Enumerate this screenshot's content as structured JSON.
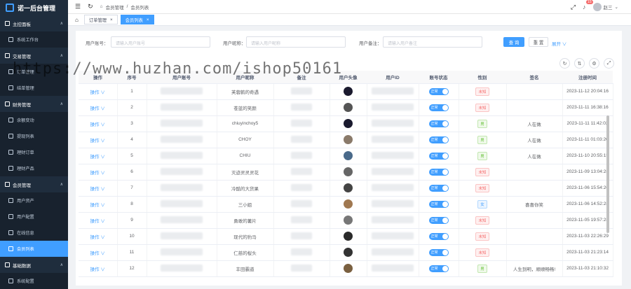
{
  "app": {
    "title": "诺一后台管理"
  },
  "sidebar": {
    "groups": [
      {
        "label": "主控面板",
        "items": [
          {
            "label": "系统工作台"
          }
        ]
      },
      {
        "label": "交易管理",
        "items": [
          {
            "label": "订单管理"
          },
          {
            "label": "结单管理"
          }
        ]
      },
      {
        "label": "财务管理",
        "items": [
          {
            "label": "余额变动"
          },
          {
            "label": "提现列表"
          },
          {
            "label": "理财订单"
          },
          {
            "label": "理财产品"
          }
        ]
      },
      {
        "label": "会员管理",
        "items": [
          {
            "label": "用户资产"
          },
          {
            "label": "用户配置"
          },
          {
            "label": "在线信息"
          },
          {
            "label": "会员列表"
          }
        ]
      },
      {
        "label": "基础数据",
        "items": [
          {
            "label": "系统配置"
          }
        ]
      }
    ],
    "active_item": "会员列表"
  },
  "header": {
    "breadcrumb": [
      "会员管理",
      "会员列表"
    ],
    "notification_count": "15",
    "user_name": "赵三"
  },
  "tabs": [
    {
      "label": "订单管理",
      "close": "×"
    },
    {
      "label": "会员列表",
      "close": "×"
    }
  ],
  "filters": {
    "account_label": "用户账号：",
    "account_placeholder": "请输入用户账号",
    "nickname_label": "用户昵称：",
    "nickname_placeholder": "请输入用户昵称",
    "remark_label": "用户备注：",
    "remark_placeholder": "请输入用户备注",
    "search_label": "查 询",
    "reset_label": "重 置",
    "expand_label": "展开 ∨"
  },
  "table": {
    "headers": [
      "操作",
      "序号",
      "用户账号",
      "用户昵称",
      "备注",
      "用户头像",
      "用户ID",
      "账号状态",
      "性别",
      "签名",
      "注册时间"
    ],
    "rows": [
      {
        "op": "操作 ∨",
        "index": "1",
        "nickname": "芙蓉鹤的奇遇",
        "status": "正常",
        "gender": "未知",
        "gender_type": "unknown",
        "signature": "",
        "time": "2023-11-12 20:04:16",
        "avatar_color": "#1a1a2e"
      },
      {
        "op": "操作 ∨",
        "index": "2",
        "nickname": "苍蓝的笑颜",
        "status": "正常",
        "gender": "未知",
        "gender_type": "unknown",
        "signature": "",
        "time": "2023-11-11 16:38:16",
        "avatar_color": "#555"
      },
      {
        "op": "操作 ∨",
        "index": "3",
        "nickname": "chiuyinchoy5",
        "status": "正常",
        "gender": "男",
        "gender_type": "female",
        "signature": "人在做",
        "time": "2023-11-11 11:42:03",
        "avatar_color": "#1a1a2e"
      },
      {
        "op": "操作 ∨",
        "index": "4",
        "nickname": "CHOY",
        "status": "正常",
        "gender": "男",
        "gender_type": "female",
        "signature": "人在做",
        "time": "2023-11-11 01:03:20",
        "avatar_color": "#8a7a6a"
      },
      {
        "op": "操作 ∨",
        "index": "5",
        "nickname": "CHIU",
        "status": "正常",
        "gender": "男",
        "gender_type": "female",
        "signature": "人在做",
        "time": "2023-11-10 20:55:15",
        "avatar_color": "#4a6a8a"
      },
      {
        "op": "操作 ∨",
        "index": "6",
        "nickname": "灭迹灵灵灵花",
        "status": "正常",
        "gender": "未知",
        "gender_type": "unknown",
        "signature": "",
        "time": "2023-11-09 13:04:28",
        "avatar_color": "#666"
      },
      {
        "op": "操作 ∨",
        "index": "7",
        "nickname": "冷酷的大货果",
        "status": "正常",
        "gender": "未知",
        "gender_type": "unknown",
        "signature": "",
        "time": "2023-11-06 15:54:20",
        "avatar_color": "#444"
      },
      {
        "op": "操作 ∨",
        "index": "8",
        "nickname": "三小姐",
        "status": "正常",
        "gender": "女",
        "gender_type": "male",
        "signature": "喜喜你笑",
        "time": "2023-11-06 14:52:28",
        "avatar_color": "#a07850"
      },
      {
        "op": "操作 ∨",
        "index": "9",
        "nickname": "勇敢的薯片",
        "status": "正常",
        "gender": "未知",
        "gender_type": "unknown",
        "signature": "",
        "time": "2023-11-05 19:57:28",
        "avatar_color": "#777"
      },
      {
        "op": "操作 ∨",
        "index": "10",
        "nickname": "现代的豹马",
        "status": "正常",
        "gender": "未知",
        "gender_type": "unknown",
        "signature": "",
        "time": "2023-11-03 22:26:29",
        "avatar_color": "#2a2a2a"
      },
      {
        "op": "操作 ∨",
        "index": "11",
        "nickname": "仁慈的桜头",
        "status": "正常",
        "gender": "未知",
        "gender_type": "unknown",
        "signature": "",
        "time": "2023-11-03 21:23:14",
        "avatar_color": "#333"
      },
      {
        "op": "操作 ∨",
        "index": "12",
        "nickname": "丰田霸道",
        "status": "正常",
        "gender": "男",
        "gender_type": "female",
        "signature": "人生到明，顺顺畅畅!",
        "time": "2023-11-03 21:10:32",
        "avatar_color": "#7a6040"
      }
    ]
  },
  "watermark": "https://www.huzhan.com/ishop50161",
  "colors": {
    "primary": "#409eff",
    "sidebar_bg": "#1f2d3d"
  }
}
